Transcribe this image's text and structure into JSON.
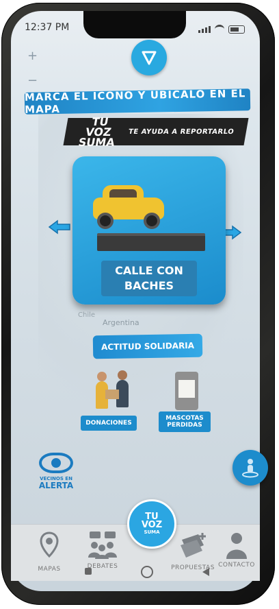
{
  "status": {
    "time": "12:37 PM"
  },
  "map": {
    "zoom_in": "+",
    "zoom_out": "−",
    "country_label": "Argentina",
    "city_label": "Chile"
  },
  "header": {
    "instruction": "MARCA EL ICONO Y UBICALO EN EL MAPA",
    "brand": "TU VOZ SUMA",
    "brand_line1": "TU VOZ",
    "brand_line2": "SUMA",
    "tagline": "TE AYUDA A REPORTARLO"
  },
  "carousel": {
    "line1": "CALLE CON",
    "line2": "BACHES",
    "prev_icon": "arrow-left-icon",
    "next_icon": "arrow-right-icon"
  },
  "solidarity": {
    "button": "ACTITUD SOLIDARIA",
    "donations": "DONACIONES",
    "pets_line1": "MASCOTAS",
    "pets_line2": "PERDIDAS"
  },
  "alert_logo": {
    "line1": "VECINOS EN",
    "line2": "ALERTA"
  },
  "tabs": [
    {
      "label": "MAPAS",
      "icon": "map-pin-icon"
    },
    {
      "label": "DEBATES",
      "icon": "debate-icon"
    },
    {
      "label": "TU VOZ SUMA",
      "icon": "brand-logo-icon"
    },
    {
      "label": "PROPUESTAS",
      "icon": "proposals-icon"
    },
    {
      "label": "CONTACTO",
      "icon": "contact-icon"
    }
  ],
  "center_logo": {
    "line1": "TU",
    "line2": "VOZ",
    "line3": "SUMA"
  },
  "colors": {
    "primary": "#29a9e0",
    "dark_blue": "#1b7bc0",
    "dark": "#222222",
    "car": "#f0c330"
  }
}
